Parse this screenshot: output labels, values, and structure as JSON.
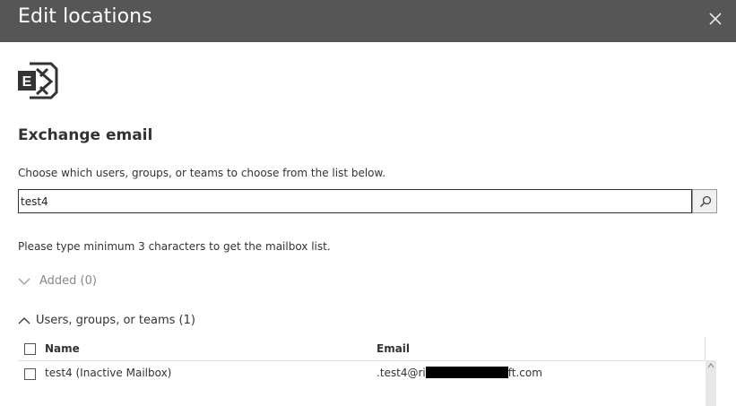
{
  "header": {
    "title": "Edit locations"
  },
  "section": {
    "title": "Exchange email",
    "instruction": "Choose which users, groups, or teams to choose from the list below."
  },
  "search": {
    "value": "test4",
    "placeholder": ""
  },
  "hint": "Please type minimum 3 characters to get the mailbox list.",
  "groups": {
    "added": {
      "label": "Added (0)"
    },
    "users": {
      "label": "Users, groups, or teams (1)"
    }
  },
  "table": {
    "columns": {
      "name": "Name",
      "email": "Email"
    },
    "rows": [
      {
        "name": "test4 (Inactive Mailbox)",
        "email_prefix": ".test4@ri",
        "email_suffix": "ft.com"
      }
    ]
  },
  "icons": {
    "logo": "exchange-logo-icon",
    "close": "close-icon",
    "search": "search-icon"
  },
  "colors": {
    "header_bg": "#565656",
    "exchange_logo": "#333333"
  }
}
